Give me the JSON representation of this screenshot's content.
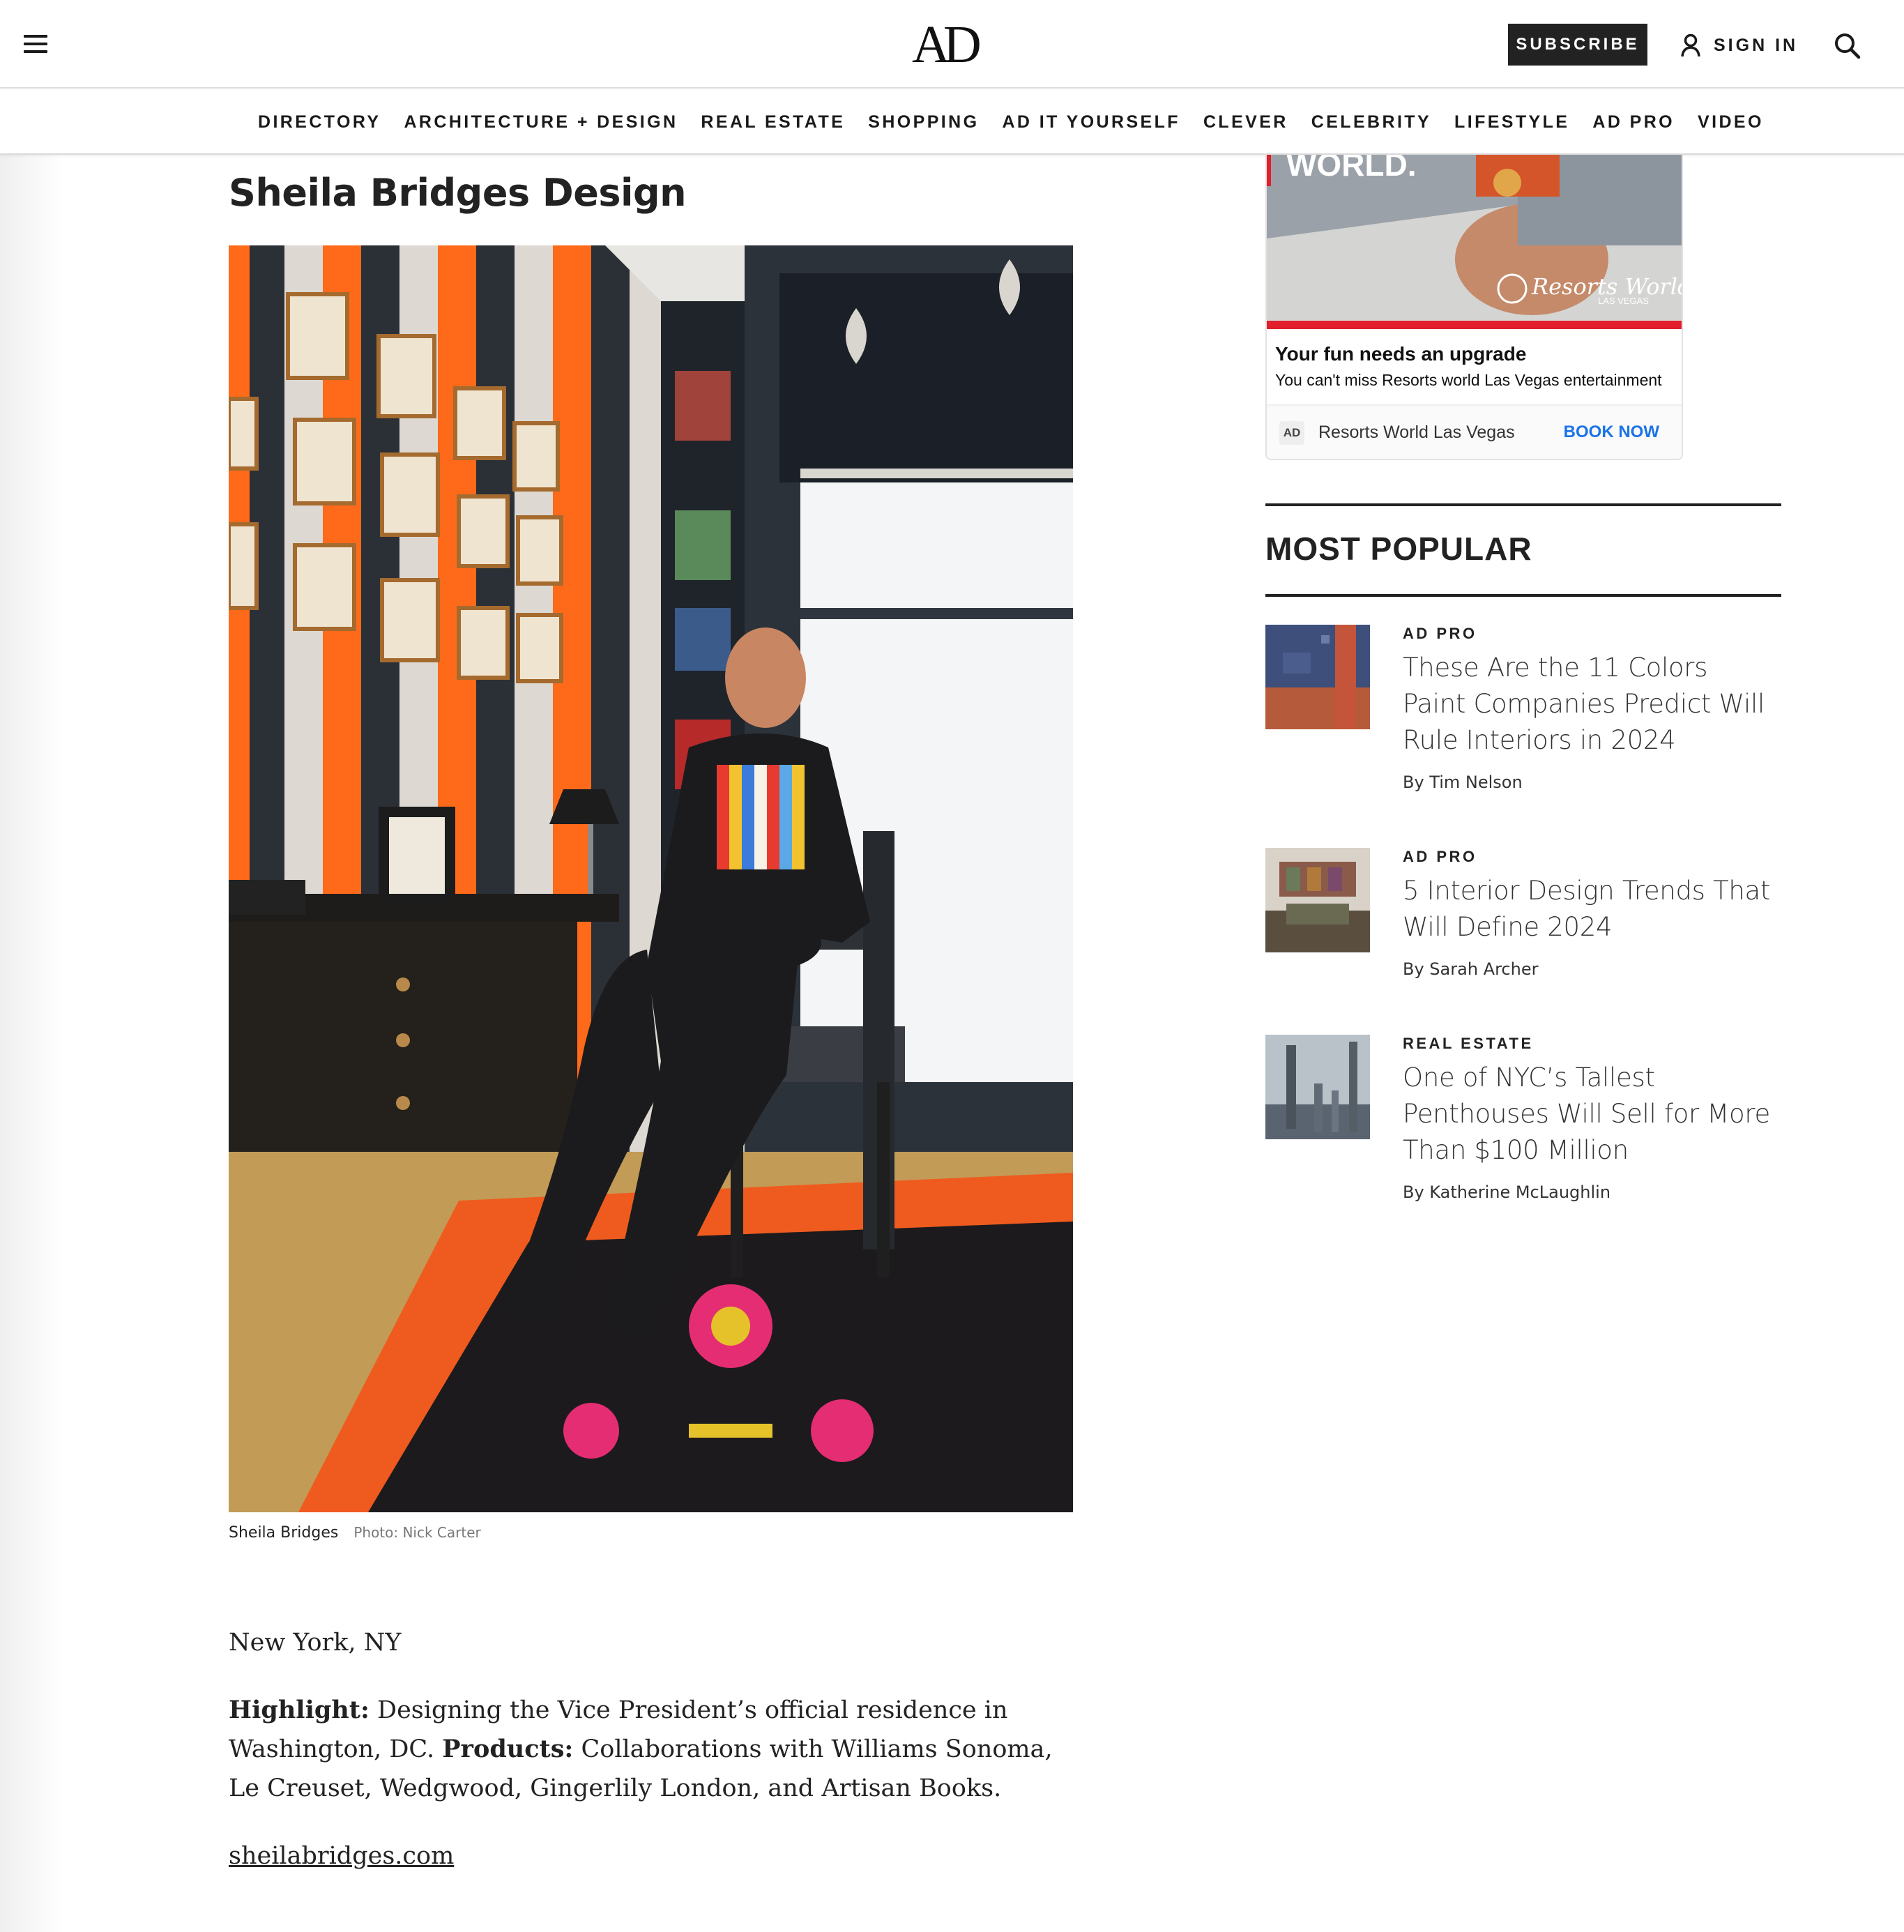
{
  "header": {
    "logo": "AD",
    "subscribe_label": "SUBSCRIBE",
    "sign_in_label": "SIGN IN"
  },
  "nav": {
    "items": [
      "DIRECTORY",
      "ARCHITECTURE + DESIGN",
      "REAL ESTATE",
      "SHOPPING",
      "AD IT YOURSELF",
      "CLEVER",
      "CELEBRITY",
      "LIFESTYLE",
      "AD PRO",
      "VIDEO"
    ]
  },
  "article": {
    "title": "Sheila Bridges Design",
    "caption": "Sheila Bridges",
    "credit": "Photo: Nick Carter",
    "location": "New York, NY",
    "highlight_label": "Highlight:",
    "highlight_text": " Designing the Vice President’s official residence in Washington, DC. ",
    "products_label": "Products:",
    "products_text": " Collaborations with Williams Sonoma, Le Creuset, Wedgwood, Gingerlily London, and Artisan Books.",
    "website": "sheilabridges.com"
  },
  "ad": {
    "image_text": "WORLD.",
    "brand_logo": "Resorts World",
    "brand_logo_sub": "LAS VEGAS",
    "headline": "Your fun needs an upgrade",
    "subline": "You can't miss Resorts world Las Vegas entertainment",
    "badge": "AD",
    "advertiser": "Resorts World Las Vegas",
    "cta": "BOOK NOW"
  },
  "most_popular": {
    "title": "MOST POPULAR",
    "items": [
      {
        "category": "AD PRO",
        "headline": "These Are the 11 Colors Paint Companies Predict Will Rule Interiors in 2024",
        "byline": "By Tim Nelson"
      },
      {
        "category": "AD PRO",
        "headline": "5 Interior Design Trends That Will Define 2024",
        "byline": "By Sarah Archer"
      },
      {
        "category": "REAL ESTATE",
        "headline": "One of NYC’s Tallest Penthouses Will Sell for More Than $100 Million",
        "byline": "By Katherine McLaughlin"
      }
    ]
  }
}
